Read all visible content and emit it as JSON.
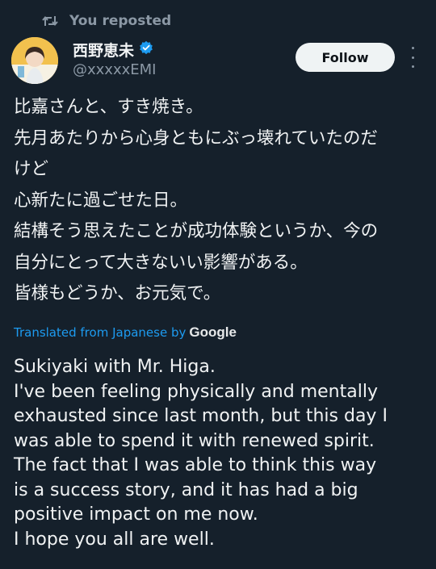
{
  "repost": {
    "label": "You reposted"
  },
  "author": {
    "display_name": "西野恵未",
    "handle": "@xxxxxEMI",
    "verified": true,
    "verified_color": "#1d9bf0"
  },
  "follow_button": {
    "label": "Follow"
  },
  "tweet": {
    "original_lines": [
      "比嘉さんと、すき焼き。",
      "先月あたりから心身ともにぶっ壊れていたのだ",
      "けど",
      "心新たに過ごせた日。",
      "結構そう思えたことが成功体験というか、今の",
      "自分にとって大きないい影響がある。",
      "皆様もどうか、お元気で。"
    ],
    "translated_from": "Translated from Japanese by",
    "translator": "Google",
    "translation_lines": [
      "Sukiyaki with Mr. Higa.",
      "I've been feeling physically and mentally",
      "exhausted since last month, but this day I",
      "was able to spend it with renewed spirit.",
      "The fact that I was able to think this way",
      "is a success story, and it has had a big",
      "positive impact on me now.",
      "I hope you all are well."
    ]
  },
  "icons": {
    "repost": "repost-icon",
    "verified": "verified-badge-icon",
    "more": "more-options-icon"
  },
  "colors": {
    "background": "#15202b",
    "accent": "#1d9bf0",
    "secondary_text": "#8b98a5"
  }
}
